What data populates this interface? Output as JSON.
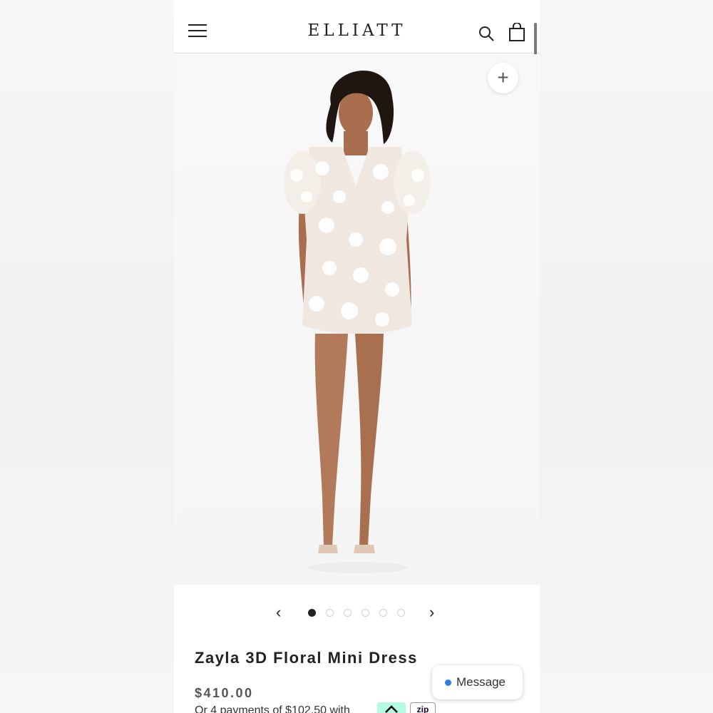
{
  "header": {
    "brand": "ELLIATT",
    "menu_icon": "hamburger-menu-icon",
    "search_icon": "search-icon",
    "bag_icon": "shopping-bag-icon"
  },
  "gallery": {
    "zoom_label": "+",
    "prev_label": "‹",
    "next_label": "›",
    "dot_count": 6,
    "active_index": 0
  },
  "product": {
    "title": "Zayla 3D Floral Mini Dress",
    "price": "$410.00",
    "installments_text": "Or 4 payments of $102.50 with",
    "zip_label": "zip"
  },
  "chat": {
    "label": "Message"
  },
  "colors": {
    "accent_blue": "#2f7de1",
    "afterpay_mint": "#b2fce4",
    "text_dark": "#222222"
  }
}
